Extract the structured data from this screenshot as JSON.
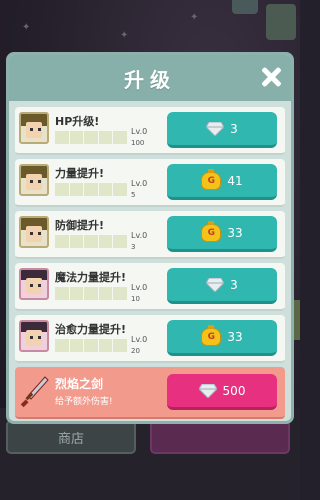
{
  "panel": {
    "title": "升级",
    "close_icon": "close-icon"
  },
  "upgrades": [
    {
      "label": "HP升级!",
      "lv_label": "Lv.0",
      "lv_value": "100",
      "cost": "3",
      "currency": "diamond",
      "avatar": "knight"
    },
    {
      "label": "力量提升!",
      "lv_label": "Lv.0",
      "lv_value": "5",
      "cost": "41",
      "currency": "gold",
      "avatar": "knight"
    },
    {
      "label": "防御提升!",
      "lv_label": "Lv.0",
      "lv_value": "3",
      "cost": "33",
      "currency": "gold",
      "avatar": "knight"
    },
    {
      "label": "魔法力量提升!",
      "lv_label": "Lv.0",
      "lv_value": "10",
      "cost": "3",
      "currency": "diamond",
      "avatar": "mage"
    },
    {
      "label": "治愈力量提升!",
      "lv_label": "Lv.0",
      "lv_value": "20",
      "cost": "33",
      "currency": "gold",
      "avatar": "healer"
    }
  ],
  "special": {
    "label": "烈焰之剑",
    "description": "给予额外伤害!",
    "cost": "500",
    "currency": "diamond"
  },
  "gold_symbol": "G",
  "background": {
    "tab_left": "商店"
  },
  "colors": {
    "teal_button": "#30b8b0",
    "pink_button": "#e83080",
    "panel_header": "#86b0a9",
    "special_row": "#f29a8c"
  }
}
